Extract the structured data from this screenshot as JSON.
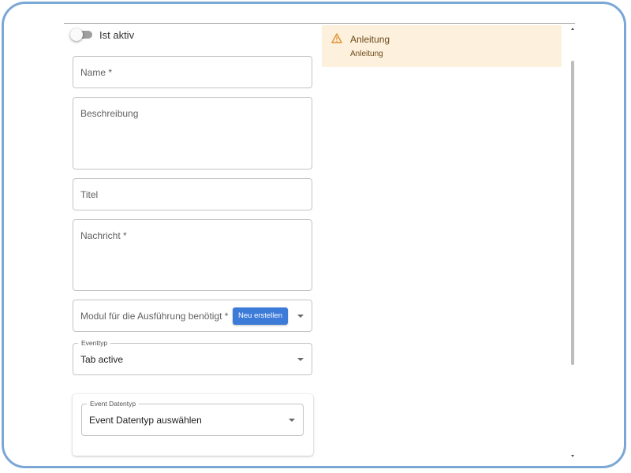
{
  "toggle": {
    "label": "Ist aktiv",
    "checked": false
  },
  "form": {
    "name_label": "Name *",
    "description_label": "Beschreibung",
    "title_label": "Titel",
    "message_label": "Nachricht *",
    "module_label": "Modul für die Ausführung benötigt *",
    "new_button_label": "Neu erstellen",
    "event_type": {
      "legend": "Eventtyp",
      "value": "Tab active"
    },
    "event_datatype": {
      "legend": "Event Datentyp",
      "value": "Event Datentyp auswählen"
    }
  },
  "alert": {
    "icon": "warning-icon",
    "title": "Anleitung",
    "text": "Anleitung",
    "background_color": "#fdf0dc",
    "icon_color": "#e0922f"
  },
  "colors": {
    "accent": "#3d7bd9",
    "frame": "#7aa7d6"
  }
}
